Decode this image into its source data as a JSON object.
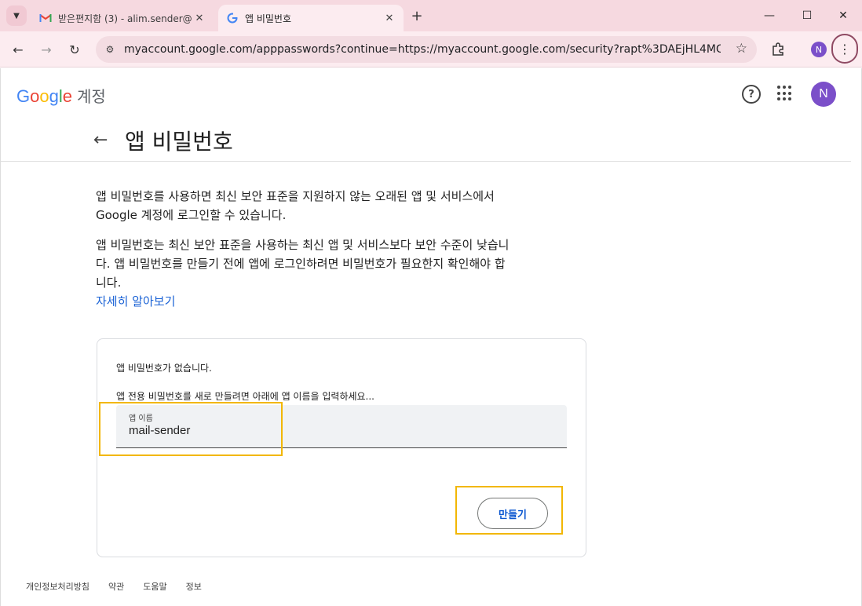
{
  "browser": {
    "tabs": [
      {
        "title": "받은편지함 (3) - alim.sender@",
        "favicon": "gmail-icon"
      },
      {
        "title": "앱 비밀번호",
        "favicon": "google-icon"
      }
    ],
    "url": "myaccount.google.com/apppasswords?continue=https://myaccount.google.com/security?rapt%3DAEjHL4MG_hZLcZ8-...",
    "profile_initial": "N"
  },
  "header": {
    "logo": "Google",
    "account_label": "계정",
    "avatar_initial": "N"
  },
  "page": {
    "title": "앱 비밀번호",
    "para1_line1": "앱 비밀번호를 사용하면 최신 보안 표준을 지원하지 않는 오래된 앱 및 서비스에서",
    "para1_line2": "Google 계정에 로그인할 수 있습니다.",
    "para2_line1": "앱 비밀번호는 최신 보안 표준을 사용하는 최신 앱 및 서비스보다 보안 수준이 낮습니",
    "para2_line2": "다. 앱 비밀번호를 만들기 전에 앱에 로그인하려면 비밀번호가 필요한지 확인해야 합",
    "para2_line3": "니다.",
    "learn_more": "자세히 알아보기"
  },
  "card": {
    "no_passwords": "앱 비밀번호가 없습니다.",
    "instruction": "앱 전용 비밀번호를 새로 만들려면 아래에 앱 이름을 입력하세요...",
    "field_label": "앱 이름",
    "field_value": "mail-sender",
    "create_label": "만들기"
  },
  "footer": [
    "개인정보처리방침",
    "약관",
    "도움말",
    "정보"
  ]
}
